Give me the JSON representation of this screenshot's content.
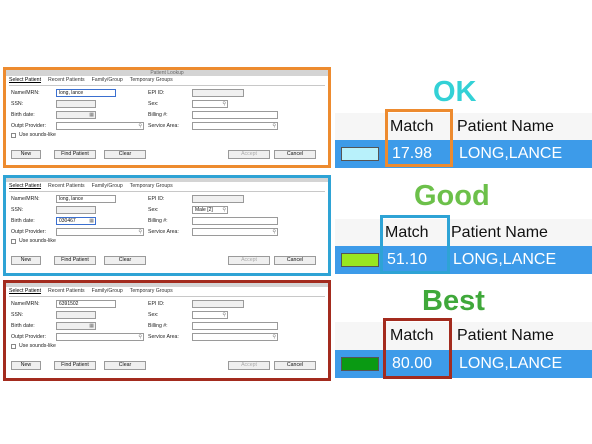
{
  "colors": {
    "ok": "#ed8b2f",
    "good": "#2ea3d5",
    "best": "#a32b1e",
    "ok_label": "#33d1d6",
    "good_label": "#6cc04a",
    "best_label": "#3fa83a",
    "row_blue": "#3d9be9"
  },
  "dialog": {
    "title": "Patient Lookup",
    "tabs": [
      "Select Patient",
      "Recent Patients",
      "Family/Group",
      "Temporary Groups"
    ],
    "labels": {
      "name_mrn": "Name/MRN:",
      "ssn": "SSN:",
      "birth_date": "Birth date:",
      "outpt_provider": "Outpt Provider:",
      "use_sounds_like": "Use sounds-like",
      "epi_id": "EPI ID:",
      "sex": "Sex:",
      "billing": "Billing #:",
      "service_area": "Service Area:"
    },
    "buttons": {
      "new": "New",
      "find_patient": "Find Patient",
      "clear": "Clear",
      "accept": "Accept",
      "cancel": "Cancel"
    }
  },
  "panels": [
    {
      "name_mrn": "long, lance",
      "birth_date": "",
      "sex": ""
    },
    {
      "name_mrn": "long, lance",
      "birth_date": "030467",
      "sex": "Male [2]"
    },
    {
      "name_mrn": "6391502",
      "birth_date": "",
      "sex": ""
    }
  ],
  "results": {
    "header": {
      "match": "Match",
      "patient_name": "Patient Name"
    },
    "rows": [
      {
        "label": "OK",
        "match": "17.98",
        "name": "LONG,LANCE",
        "swatch_color": "#b8f1fb"
      },
      {
        "label": "Good",
        "match": "51.10",
        "name": "LONG,LANCE",
        "swatch_color": "#99e620"
      },
      {
        "label": "Best",
        "match": "80.00",
        "name": "LONG,LANCE",
        "swatch_color": "#0a9a13"
      }
    ]
  }
}
